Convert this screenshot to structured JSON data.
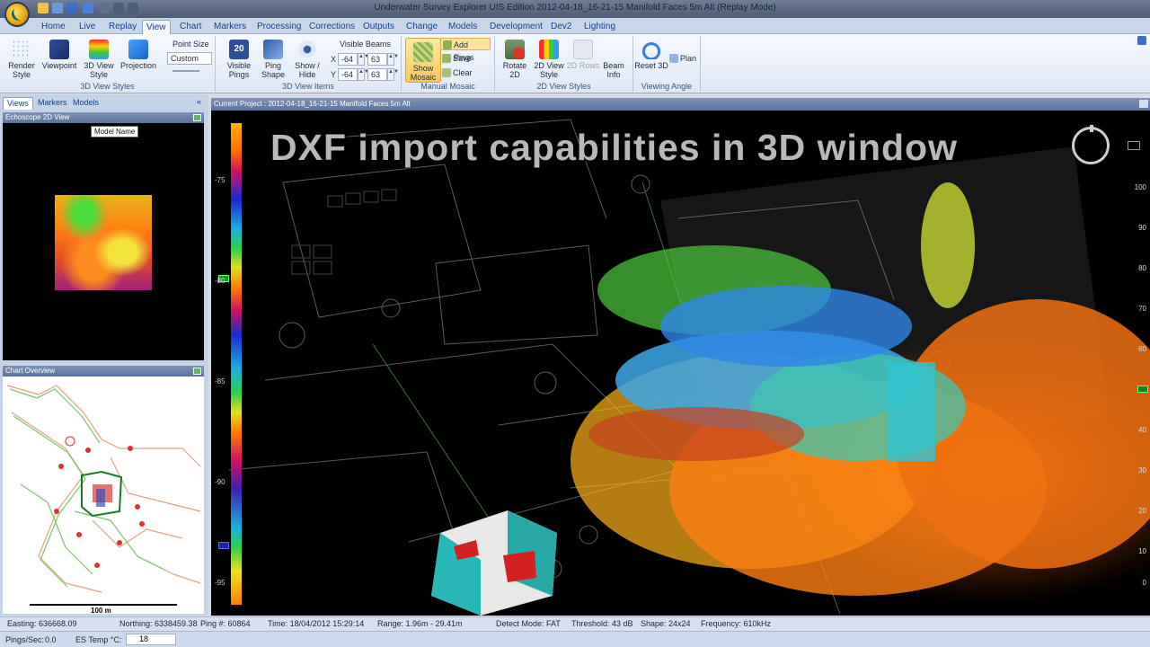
{
  "window": {
    "title": "Underwater Survey Explorer UIS Edition 2012-04-18_16-21-15 Manifold Faces 5m Alt (Replay Mode)"
  },
  "tabs": [
    "Home",
    "Live",
    "Replay",
    "View",
    "Chart",
    "Markers",
    "Processing",
    "Corrections",
    "Outputs",
    "Change",
    "Models",
    "Development",
    "Dev2",
    "Lighting"
  ],
  "active_tab": "View",
  "ribbon": {
    "render_style": "Render Style",
    "viewpoint": "Viewpoint",
    "view_style_3d": "3D View Style",
    "projection": "Projection",
    "point_size_label": "Point Size",
    "point_size_value": "Custom",
    "group_3d_view_styles": "3D View Styles",
    "visible_pings": "Visible Pings",
    "ping_shape": "Ping Shape",
    "show_hide": "Show / Hide",
    "visible_beams_label": "Visible Beams",
    "x_label": "X",
    "y_label": "Y",
    "x_from": "-64",
    "x_to": "63",
    "y_from": "-64",
    "y_to": "63",
    "group_3d_view_items": "3D View Items",
    "show_mosaic": "Show Mosaic",
    "add_pings": "Add Pings",
    "save": "Save",
    "clear": "Clear",
    "group_manual_mosaic": "Manual Mosaic",
    "rotate_2d": "Rotate 2D",
    "view_style_2d": "2D View Style",
    "rows_2d": "2D Rows",
    "beam_info": "Beam Info",
    "group_2d_view_styles": "2D View Styles",
    "reset_3d": "Reset 3D",
    "plan": "Plan",
    "group_viewing_angle": "Viewing Angle"
  },
  "left_panel": {
    "tabs": [
      "Views",
      "Markers",
      "Models"
    ],
    "echoscope_header": "Echoscope 2D View",
    "tooltip": "Model Name",
    "chart_header": "Chart Overview",
    "scale_label": "100 m"
  },
  "viewport": {
    "header": "Current Project : 2012-04-18_16-21-15 Manifold Faces 5m Alt",
    "overlay_title": "DXF import capabilities in 3D window",
    "left_scale": [
      "-75",
      "-80",
      "-85",
      "-90",
      "-95"
    ],
    "right_scale": [
      "100",
      "90",
      "80",
      "70",
      "60",
      "50",
      "40",
      "30",
      "20",
      "10",
      "0"
    ]
  },
  "status": {
    "easting": "Easting:  636668.09",
    "northing": "Northing:  6338459.38",
    "ping": "Ping #:  60864",
    "time": "Time:  18/04/2012 15:29:14",
    "range": "Range:  1.96m - 29.41m",
    "detect": "Detect Mode:  FAT",
    "threshold": "Threshold:  43 dB",
    "shape": "Shape:  24x24",
    "frequency": "Frequency:  610kHz",
    "pings_sec_label": "Pings/Sec:",
    "pings_sec_value": "0.0",
    "es_temp_label": "ES Temp °C:",
    "es_temp_value": "18"
  },
  "colors": {
    "ribbon_bg": "#dfe8f5",
    "panel_header": "#5c739c",
    "highlight": "#f7c95b"
  }
}
